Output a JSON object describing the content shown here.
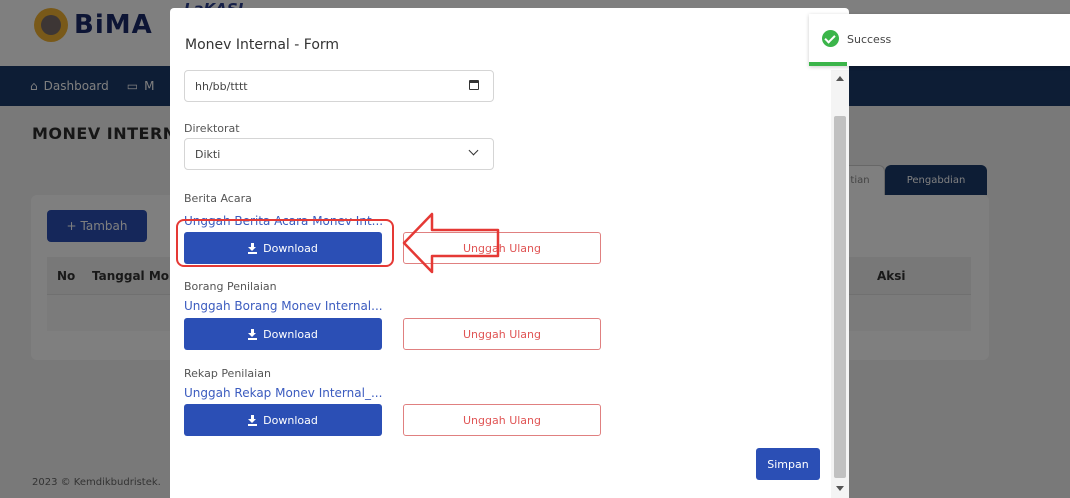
{
  "app": {
    "logo_text": "BiMA",
    "logo2_text": "LaKASI",
    "nav": [
      {
        "label": "Dashboard",
        "icon": "home-icon"
      },
      {
        "label": "M",
        "icon": "monitor-icon"
      }
    ],
    "page_title": "MONEV INTERNA",
    "tambah_label": "Tambah",
    "table_headers": {
      "no": "No",
      "tanggal": "Tanggal Mon",
      "aksi": "Aksi"
    },
    "tabs": [
      {
        "label": "tian"
      },
      {
        "label": "Pengabdian"
      }
    ],
    "footer": "2023 © Kemdikbudristek."
  },
  "modal": {
    "title": "Monev Internal - Form",
    "date_value": "hh/bb/tttt",
    "direktorat_label": "Direktorat",
    "direktorat_value": "Dikti",
    "sections": [
      {
        "label": "Berita Acara",
        "link": "Unggah Berita Acara Monev Int...",
        "download": "Download",
        "reupload": "Unggah Ulang"
      },
      {
        "label": "Borang Penilaian",
        "link": "Unggah Borang Monev Internal...",
        "download": "Download",
        "reupload": "Unggah Ulang"
      },
      {
        "label": "Rekap Penilaian",
        "link": "Unggah Rekap Monev Internal_...",
        "download": "Download",
        "reupload": "Unggah Ulang"
      }
    ],
    "simpan_label": "Simpan"
  },
  "toast": {
    "message": "Success"
  },
  "colors": {
    "primary": "#2b4fb5",
    "navbar": "#1a3a6b",
    "danger": "#e05555",
    "success": "#3bb54a",
    "annotation": "#e53935"
  }
}
